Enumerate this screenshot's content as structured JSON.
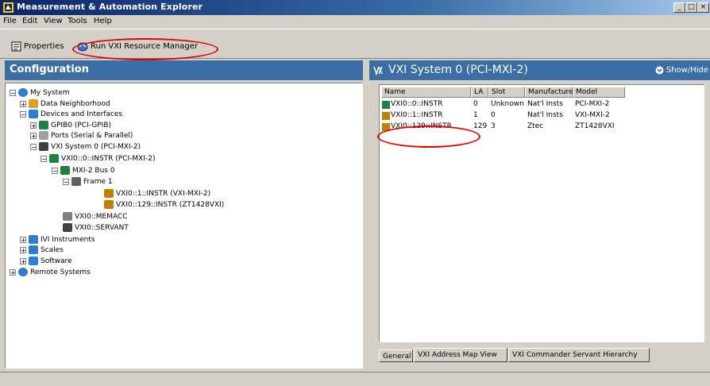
{
  "window": {
    "title": "Measurement & Automation Explorer",
    "buttons": [
      "_",
      "□",
      "×"
    ]
  },
  "menu": [
    "File",
    "Edit",
    "View",
    "Tools",
    "Help"
  ],
  "toolbar": {
    "properties_label": "Properties",
    "run_vxi_label": "Run VXI Resource Manager"
  },
  "config": {
    "header": "Configuration",
    "tree": [
      {
        "label": "My System",
        "exp": "−",
        "icon": "computer-icon"
      },
      {
        "label": "Data Neighborhood",
        "exp": "+",
        "icon": "data-neighborhood-icon"
      },
      {
        "label": "Devices and Interfaces",
        "exp": "−",
        "icon": "devices-folder-icon"
      },
      {
        "label": "GPIB0 (PCI-GPIB)",
        "exp": "+",
        "icon": "gpib-icon"
      },
      {
        "label": "Ports (Serial & Parallel)",
        "exp": "+",
        "icon": "ports-icon"
      },
      {
        "label": "VXI System 0 (PCI-MXI-2)",
        "exp": "−",
        "icon": "vxi-system-icon"
      },
      {
        "label": "VXI0::0::INSTR (PCI-MXI-2)",
        "exp": "−",
        "icon": "board-icon"
      },
      {
        "label": "MXI-2 Bus 0",
        "exp": "−",
        "icon": "bus-icon"
      },
      {
        "label": "Frame 1",
        "exp": "−",
        "icon": "frame-icon"
      },
      {
        "label": "VXI0::1::INSTR (VXI-MXI-2)",
        "exp": "",
        "icon": "module-icon"
      },
      {
        "label": "VXI0::129::INSTR (ZT1428VXI)",
        "exp": "",
        "icon": "module-icon"
      },
      {
        "label": "VXI0::MEMACC",
        "exp": "",
        "icon": "memacc-icon"
      },
      {
        "label": "VXI0::SERVANT",
        "exp": "",
        "icon": "servant-icon"
      },
      {
        "label": "IVI Instruments",
        "exp": "+",
        "icon": "ivi-icon"
      },
      {
        "label": "Scales",
        "exp": "+",
        "icon": "scales-icon"
      },
      {
        "label": "Software",
        "exp": "+",
        "icon": "software-icon"
      },
      {
        "label": "Remote Systems",
        "exp": "+",
        "icon": "remote-systems-icon"
      }
    ]
  },
  "detail": {
    "header": "VXI System 0 (PCI-MXI-2)",
    "show_hide": "Show/Hide",
    "columns": [
      "Name",
      "LA",
      "Slot",
      "Manufacturer",
      "Model"
    ],
    "rows": [
      [
        "VXI0::0::INSTR",
        "0",
        "Unknown",
        "Nat'l Insts",
        "PCI-MXI-2"
      ],
      [
        "VXI0::1::INSTR",
        "1",
        "0",
        "Nat'l Insts",
        "VXI-MXI-2"
      ],
      [
        "VXI0::129::INSTR",
        "129",
        "3",
        "Ztec",
        "ZT1428VXI"
      ]
    ],
    "tabs": [
      "General",
      "VXI Address Map View",
      "VXI Commander Servant Hierarchy"
    ]
  },
  "colors": {
    "annotation": "#e00000",
    "pane_header": "#3a6ea5",
    "title_bar": "#0a246a"
  }
}
